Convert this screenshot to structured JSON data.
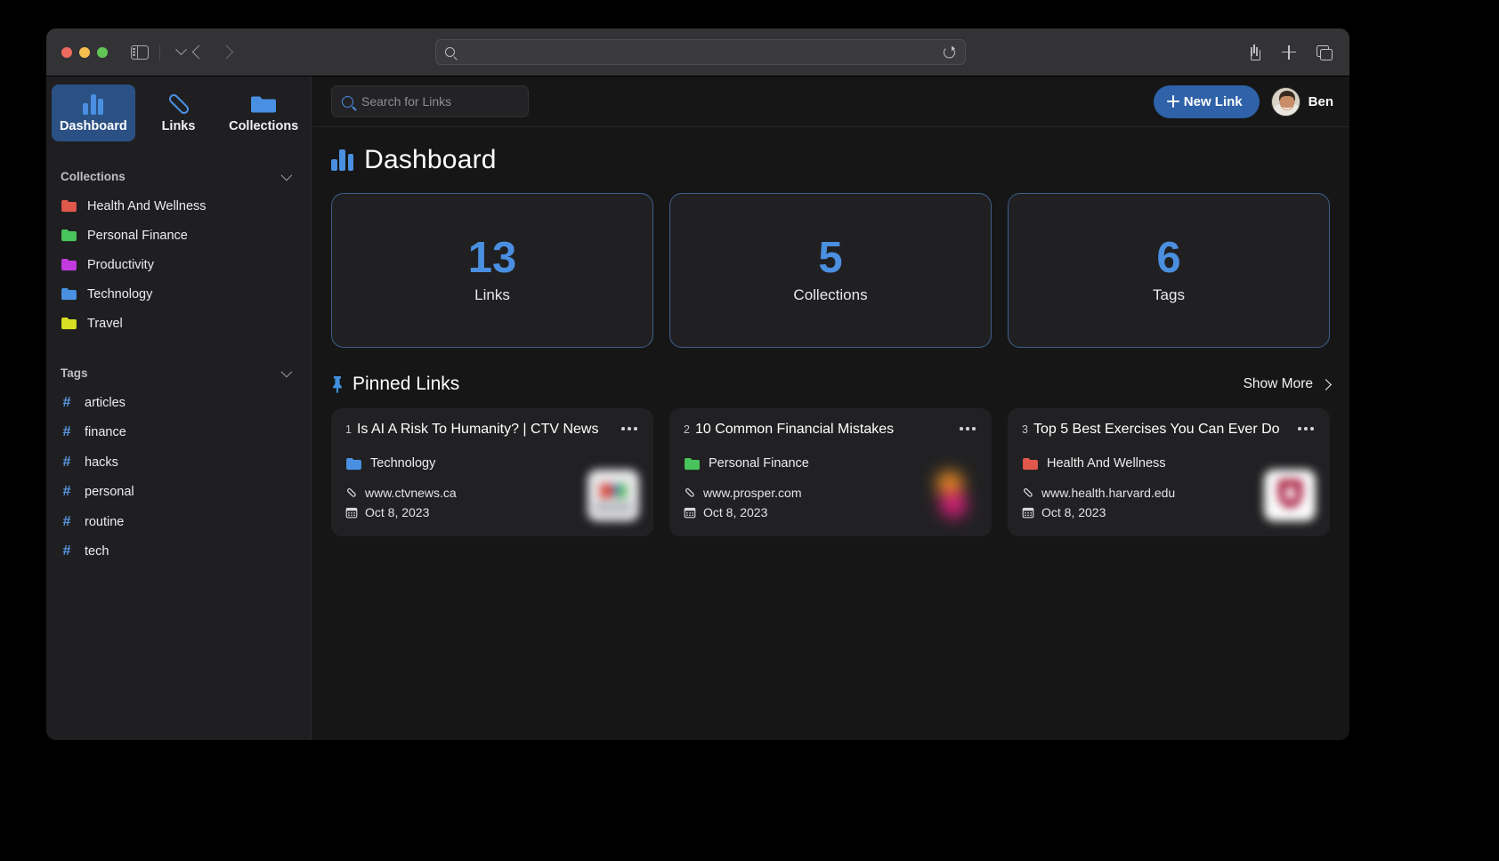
{
  "browser": {
    "url_placeholder": "",
    "sidebar_toggle": "sidebar-toggle",
    "back": "back",
    "forward": "forward"
  },
  "sidebar": {
    "nav_tabs": [
      {
        "label": "Dashboard",
        "icon": "chart-bar-icon",
        "active": true
      },
      {
        "label": "Links",
        "icon": "link-icon",
        "active": false
      },
      {
        "label": "Collections",
        "icon": "folder-icon",
        "active": false
      }
    ],
    "collections_section": {
      "title": "Collections",
      "items": [
        {
          "label": "Health And Wellness",
          "color": "#e0574b"
        },
        {
          "label": "Personal Finance",
          "color": "#49c45c"
        },
        {
          "label": "Productivity",
          "color": "#c23ae0"
        },
        {
          "label": "Technology",
          "color": "#4a90e2"
        },
        {
          "label": "Travel",
          "color": "#d8e023"
        }
      ]
    },
    "tags_section": {
      "title": "Tags",
      "items": [
        {
          "label": "articles"
        },
        {
          "label": "finance"
        },
        {
          "label": "hacks"
        },
        {
          "label": "personal"
        },
        {
          "label": "routine"
        },
        {
          "label": "tech"
        }
      ]
    }
  },
  "header": {
    "search": {
      "placeholder": "Search for Links",
      "value": ""
    },
    "new_link_label": "New Link",
    "user_name": "Ben"
  },
  "page": {
    "title": "Dashboard",
    "stats": [
      {
        "value": "13",
        "label": "Links"
      },
      {
        "value": "5",
        "label": "Collections"
      },
      {
        "value": "6",
        "label": "Tags"
      }
    ],
    "pinned": {
      "title": "Pinned Links",
      "show_more_label": "Show More",
      "cards": [
        {
          "index": "1",
          "title": "Is AI A Risk To Humanity? | CTV News",
          "collection": "Technology",
          "collection_color": "#4a90e2",
          "url": "www.ctvnews.ca",
          "date": "Oct 8, 2023",
          "thumb": "thumb-ctv"
        },
        {
          "index": "2",
          "title": "10 Common Financial Mistakes",
          "collection": "Personal Finance",
          "collection_color": "#49c45c",
          "url": "www.prosper.com",
          "date": "Oct 8, 2023",
          "thumb": "thumb-prosper"
        },
        {
          "index": "3",
          "title": "Top 5 Best Exercises You Can Ever Do",
          "collection": "Health And Wellness",
          "collection_color": "#e0574b",
          "url": "www.health.harvard.edu",
          "date": "Oct 8, 2023",
          "thumb": "thumb-harvard"
        }
      ]
    }
  },
  "colors": {
    "accent": "#4a8fe0",
    "button": "#2f62a8",
    "card_border": "#3d5f8a",
    "app_bg": "#161617",
    "sidebar_bg": "#1f1f21"
  }
}
